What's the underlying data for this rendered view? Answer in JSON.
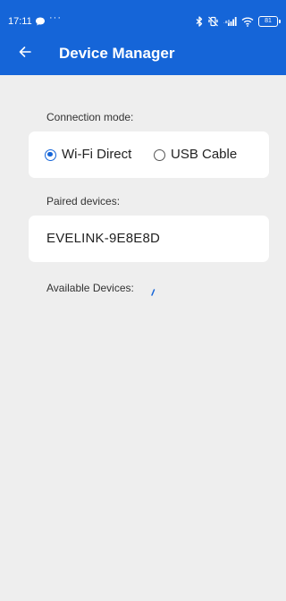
{
  "status_bar": {
    "time": "17:11",
    "dots": "···",
    "battery": "81"
  },
  "toolbar": {
    "title": "Device Manager",
    "back_icon": "arrow-left-icon"
  },
  "connection": {
    "label": "Connection mode:",
    "options": [
      {
        "label": "Wi-Fi Direct",
        "selected": true
      },
      {
        "label": "USB Cable",
        "selected": false
      }
    ]
  },
  "paired": {
    "label": "Paired devices:",
    "devices": [
      "EVELINK-9E8E8D"
    ]
  },
  "available": {
    "label": "Available Devices:"
  },
  "colors": {
    "accent": "#1565d8",
    "background": "#eeeeee",
    "card": "#ffffff"
  }
}
